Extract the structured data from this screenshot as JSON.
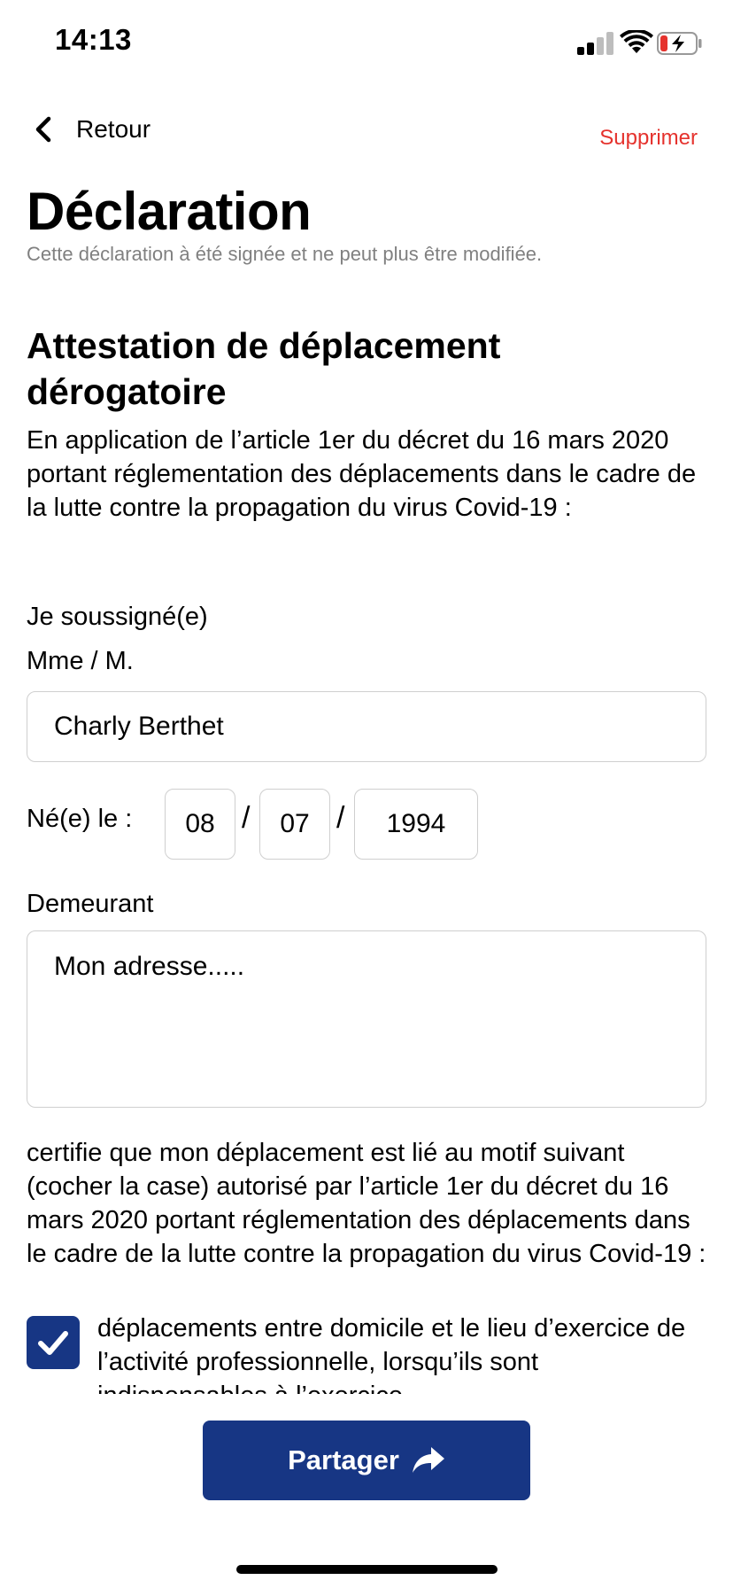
{
  "status_bar": {
    "time": "14:13",
    "signal_icon": "cellular-signal-icon",
    "wifi_icon": "wifi-icon",
    "battery_icon": "battery-charging-icon",
    "battery_color": "#e5322d"
  },
  "nav": {
    "back_label": "Retour",
    "back_icon": "chevron-left-icon",
    "delete_label": "Supprimer",
    "delete_color": "#e5322d"
  },
  "header": {
    "title": "Déclaration",
    "subtitle": "Cette déclaration à été signée et ne peut plus être modifiée."
  },
  "attestation": {
    "title": "Attestation de déplacement dérogatoire",
    "intro": "En application de l’article 1er du décret du 16 mars 2020 portant réglementation des déplacements dans le cadre de la lutte contre la propagation du virus Covid-19 :"
  },
  "form": {
    "soussigne_label": "Je soussigné(e)",
    "name_label": "Mme / M.",
    "name_value": "Charly Berthet",
    "birth_label": "Né(e) le :",
    "birth_day": "08",
    "birth_month": "07",
    "birth_year": "1994",
    "date_separator": "/",
    "address_label": "Demeurant",
    "address_value": "Mon adresse....."
  },
  "certification": {
    "text": "certifie que mon déplacement est lié au motif suivant (cocher la case) autorisé par l’article 1er du décret du 16 mars 2020 portant réglementation des déplacements dans le cadre de la lutte contre la propagation du virus Covid-19 :",
    "reason_checked": true,
    "reason_text": "déplacements entre domicile et le lieu d’exercice de l’activité professionnelle, lorsqu’ils sont indispensables à l’exercice"
  },
  "actions": {
    "share_label": "Partager",
    "share_icon": "share-arrow-icon",
    "primary_color": "#173684"
  }
}
